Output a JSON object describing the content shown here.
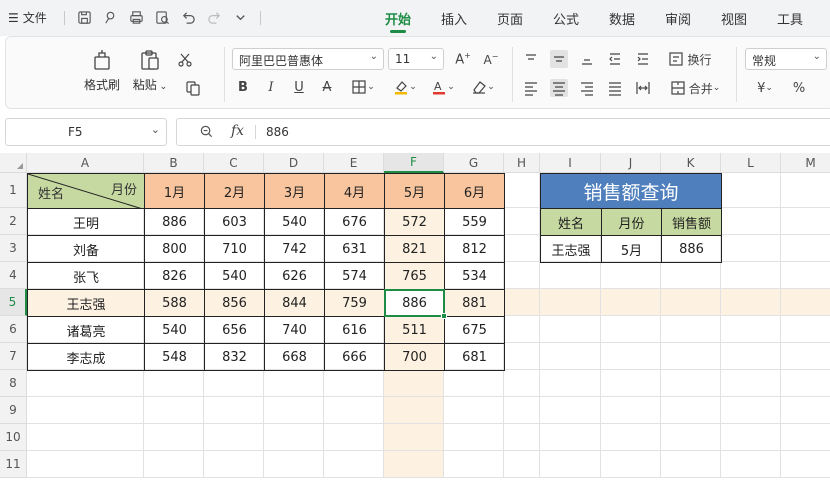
{
  "menu": {
    "file_label": "文件",
    "tabs": [
      "开始",
      "插入",
      "页面",
      "公式",
      "数据",
      "审阅",
      "视图",
      "工具"
    ],
    "active_tab": "开始"
  },
  "ribbon": {
    "format_painter": "格式刷",
    "paste": "粘贴",
    "font_name": "阿里巴巴普惠体",
    "font_size": "11",
    "wrap_text": "换行",
    "merge": "合并",
    "number_format": "常规",
    "currency_symbol": "¥",
    "percent_symbol": "%"
  },
  "formula_bar": {
    "name_box": "F5",
    "fx_label": "fx",
    "formula": "886"
  },
  "grid": {
    "columns": [
      "A",
      "B",
      "C",
      "D",
      "E",
      "F",
      "G",
      "H",
      "I",
      "J",
      "K",
      "L",
      "M"
    ],
    "rows": [
      "1",
      "2",
      "3",
      "4",
      "5",
      "6",
      "7",
      "8",
      "9",
      "10",
      "11"
    ],
    "selected_column": "F",
    "selected_row": "5",
    "header_month": "月份",
    "header_name": "姓名",
    "months": [
      "1月",
      "2月",
      "3月",
      "4月",
      "5月",
      "6月"
    ],
    "table_rows": [
      {
        "name": "王明",
        "values": [
          "886",
          "603",
          "540",
          "676",
          "572",
          "559"
        ]
      },
      {
        "name": "刘备",
        "values": [
          "800",
          "710",
          "742",
          "631",
          "821",
          "812"
        ]
      },
      {
        "name": "张飞",
        "values": [
          "826",
          "540",
          "626",
          "574",
          "765",
          "534"
        ]
      },
      {
        "name": "王志强",
        "values": [
          "588",
          "856",
          "844",
          "759",
          "886",
          "881"
        ]
      },
      {
        "name": "诸葛亮",
        "values": [
          "540",
          "656",
          "740",
          "616",
          "511",
          "675"
        ]
      },
      {
        "name": "李志成",
        "values": [
          "548",
          "832",
          "668",
          "666",
          "700",
          "681"
        ]
      }
    ]
  },
  "lookup": {
    "title": "销售额查询",
    "headers": [
      "姓名",
      "月份",
      "销售额"
    ],
    "values": [
      "王志强",
      "5月",
      "886"
    ]
  },
  "colors": {
    "accent_green": "#1e8c45",
    "header_orange": "#f8c59e",
    "header_green": "#c5d9a1",
    "title_blue": "#4f80bd",
    "selection_tint": "#fdf2e2"
  }
}
